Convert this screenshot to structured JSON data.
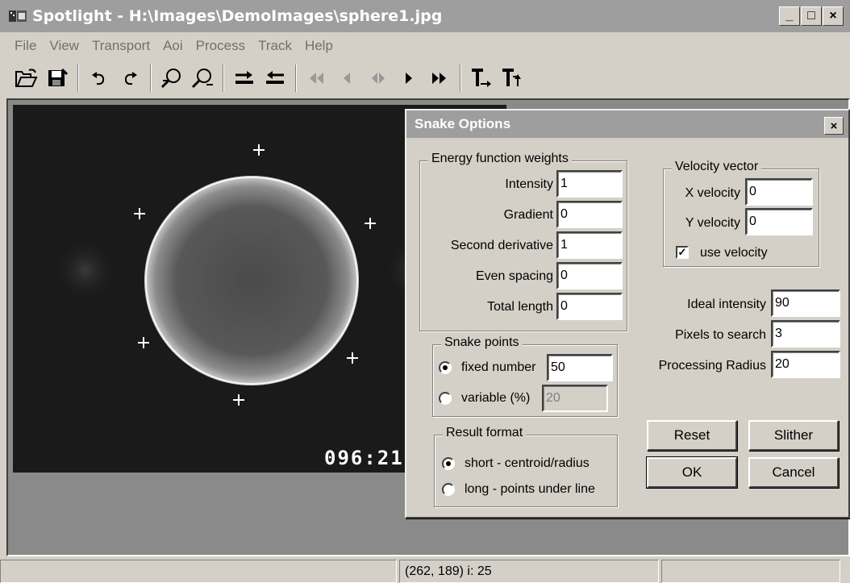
{
  "window": {
    "title": "Spotlight - H:\\Images\\DemoImages\\sphere1.jpg",
    "minimize": "_",
    "maximize": "□",
    "close": "×"
  },
  "menu": [
    "File",
    "View",
    "Transport",
    "Aoi",
    "Process",
    "Track",
    "Help"
  ],
  "toolbar": [
    "open-icon",
    "save-icon",
    "undo-icon",
    "redo-icon",
    "zoom-in-icon",
    "zoom-out-icon",
    "arrow-right-icon",
    "arrow-left-icon",
    "rewind-icon",
    "step-back-icon",
    "frame-icon",
    "play-icon",
    "fast-forward-icon",
    "text-right-icon",
    "text-up-icon"
  ],
  "image": {
    "timestamp": "096:21"
  },
  "status": {
    "left": "",
    "middle": "(262, 189) i: 25",
    "right": ""
  },
  "dialog": {
    "title": "Snake Options",
    "close": "×",
    "energy": {
      "legend": "Energy function weights",
      "intensity": {
        "label": "Intensity",
        "value": "1"
      },
      "gradient": {
        "label": "Gradient",
        "value": "0"
      },
      "second_derivative": {
        "label": "Second derivative",
        "value": "1"
      },
      "even_spacing": {
        "label": "Even spacing",
        "value": "0"
      },
      "total_length": {
        "label": "Total length",
        "value": "0"
      }
    },
    "velocity": {
      "legend": "Velocity vector",
      "x": {
        "label": "X velocity",
        "value": "0"
      },
      "y": {
        "label": "Y velocity",
        "value": "0"
      },
      "use": {
        "label": "use velocity",
        "checked": true
      }
    },
    "ideal_intensity": {
      "label": "Ideal intensity",
      "value": "90"
    },
    "pixels_to_search": {
      "label": "Pixels to search",
      "value": "3"
    },
    "processing_radius": {
      "label": "Processing Radius",
      "value": "20"
    },
    "snake_points": {
      "legend": "Snake points",
      "fixed": {
        "label": "fixed number",
        "value": "50",
        "selected": true
      },
      "variable": {
        "label": "variable (%)",
        "value": "20",
        "selected": false
      }
    },
    "result_format": {
      "legend": "Result format",
      "short": {
        "label": "short - centroid/radius",
        "selected": true
      },
      "long": {
        "label": "long - points under line",
        "selected": false
      }
    },
    "buttons": {
      "reset": "Reset",
      "slither": "Slither",
      "ok": "OK",
      "cancel": "Cancel"
    }
  }
}
